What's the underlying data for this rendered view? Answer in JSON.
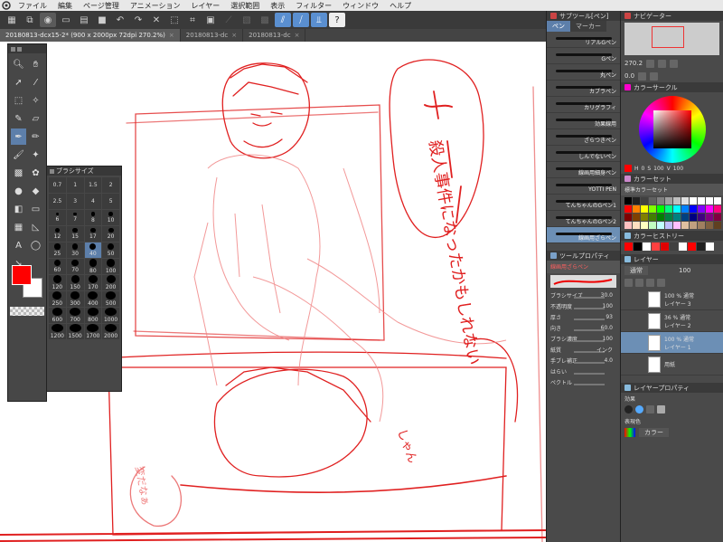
{
  "menu": {
    "items": [
      "ファイル",
      "編集",
      "ページ管理",
      "アニメーション",
      "レイヤー",
      "選択範囲",
      "表示",
      "フィルター",
      "ウィンドウ",
      "ヘルプ"
    ]
  },
  "tabs": [
    {
      "label": "20180813-dcx15-2* (900 x 2000px 72dpi 270.2%)",
      "active": true
    },
    {
      "label": "20180813-dc",
      "active": false
    },
    {
      "label": "20180813-dc",
      "active": false
    }
  ],
  "brush_size": {
    "title": "ブラシサイズ",
    "sizes": [
      "0.7",
      "1",
      "1.5",
      "2",
      "2.5",
      "3",
      "4",
      "5",
      "6",
      "7",
      "8",
      "10",
      "12",
      "15",
      "17",
      "20",
      "25",
      "30",
      "40",
      "50",
      "60",
      "70",
      "80",
      "100",
      "120",
      "150",
      "170",
      "200",
      "250",
      "300",
      "400",
      "500",
      "600",
      "700",
      "800",
      "1000",
      "1200",
      "1500",
      "1700",
      "2000"
    ],
    "selected": "40"
  },
  "subtool": {
    "title": "サブツール[ペン]",
    "tabs": [
      "ペン",
      "マーカー"
    ],
    "brushes": [
      "リアルGペン",
      "Gペン",
      "丸ペン",
      "カブラペン",
      "カリグラフィ",
      "効果線用",
      "ざらつきペン",
      "しんでないペン",
      "線画用細身ペン",
      "YOTTI PEN",
      "てんちゃんのGペン1",
      "てんちゃんのGペン2",
      "線画用ざらペン"
    ],
    "selected": "線画用ざらペン"
  },
  "tool_property": {
    "title": "ツールプロパティ",
    "tool_name": "線画用ざらペン",
    "props": [
      {
        "label": "ブラシサイズ",
        "value": "30.0"
      },
      {
        "label": "不透明度",
        "value": "100"
      },
      {
        "label": "厚さ",
        "value": "93"
      },
      {
        "label": "向き",
        "value": "60.0"
      },
      {
        "label": "ブラシ濃度",
        "value": "100"
      },
      {
        "label": "紙質",
        "value": "インク"
      },
      {
        "label": "手ブレ補正",
        "value": "4.0"
      },
      {
        "label": "はらい",
        "value": ""
      },
      {
        "label": "ペクトル",
        "value": ""
      }
    ]
  },
  "navigator": {
    "title": "ナビゲーター",
    "zoom": "270.2",
    "angle": "0.0"
  },
  "color_circle": {
    "title": "カラーサークル",
    "h": "0",
    "s": "100",
    "v": "100"
  },
  "color_set": {
    "title": "カラーセット",
    "set_name": "標準カラーセット",
    "colors": [
      "#000000",
      "#202020",
      "#404040",
      "#606060",
      "#808080",
      "#a0a0a0",
      "#c0c0c0",
      "#e0e0e0",
      "#ffffff",
      "#ffffff",
      "#ffffff",
      "#ffffff",
      "#ff0000",
      "#ff8000",
      "#ffff00",
      "#80ff00",
      "#00ff00",
      "#00ff80",
      "#00ffff",
      "#0080ff",
      "#0000ff",
      "#8000ff",
      "#ff00ff",
      "#ff0080",
      "#800000",
      "#804000",
      "#808000",
      "#408000",
      "#008000",
      "#008040",
      "#008080",
      "#004080",
      "#000080",
      "#400080",
      "#800080",
      "#800040",
      "#ffc0c0",
      "#ffe0c0",
      "#ffffc0",
      "#c0ffc0",
      "#c0ffff",
      "#c0c0ff",
      "#ffc0ff",
      "#e0c0a0",
      "#c0a080",
      "#a08060",
      "#806040",
      "#604020"
    ]
  },
  "color_history": {
    "title": "カラーヒストリー",
    "colors": [
      "#ff0000",
      "#000000",
      "#ffffff",
      "#ff4040",
      "#e00000",
      "#404040",
      "#ffffff",
      "#ff0000",
      "#202020",
      "#ffffff"
    ]
  },
  "layer": {
    "title": "レイヤー",
    "blend": "通常",
    "opacity": "100",
    "layers": [
      {
        "pct": "100 % 通常",
        "name": "レイヤー 3",
        "selected": false
      },
      {
        "pct": "36 % 通常",
        "name": "レイヤー 2",
        "selected": false
      },
      {
        "pct": "100 % 通常",
        "name": "レイヤー 1",
        "selected": true
      },
      {
        "pct": "",
        "name": "用紙",
        "selected": false
      }
    ]
  },
  "layer_property": {
    "title": "レイヤープロパティ",
    "effect_label": "効果",
    "display_color_label": "表現色",
    "display_color_value": "カラー"
  },
  "colors": {
    "main": "#ff0000",
    "sub": "#ffffff",
    "accent": "#5d7faa"
  },
  "drawing_text": {
    "bubble": "殺人事件になったかもしれない",
    "side": "しゃん",
    "bottom_left": "変だなぁ"
  }
}
